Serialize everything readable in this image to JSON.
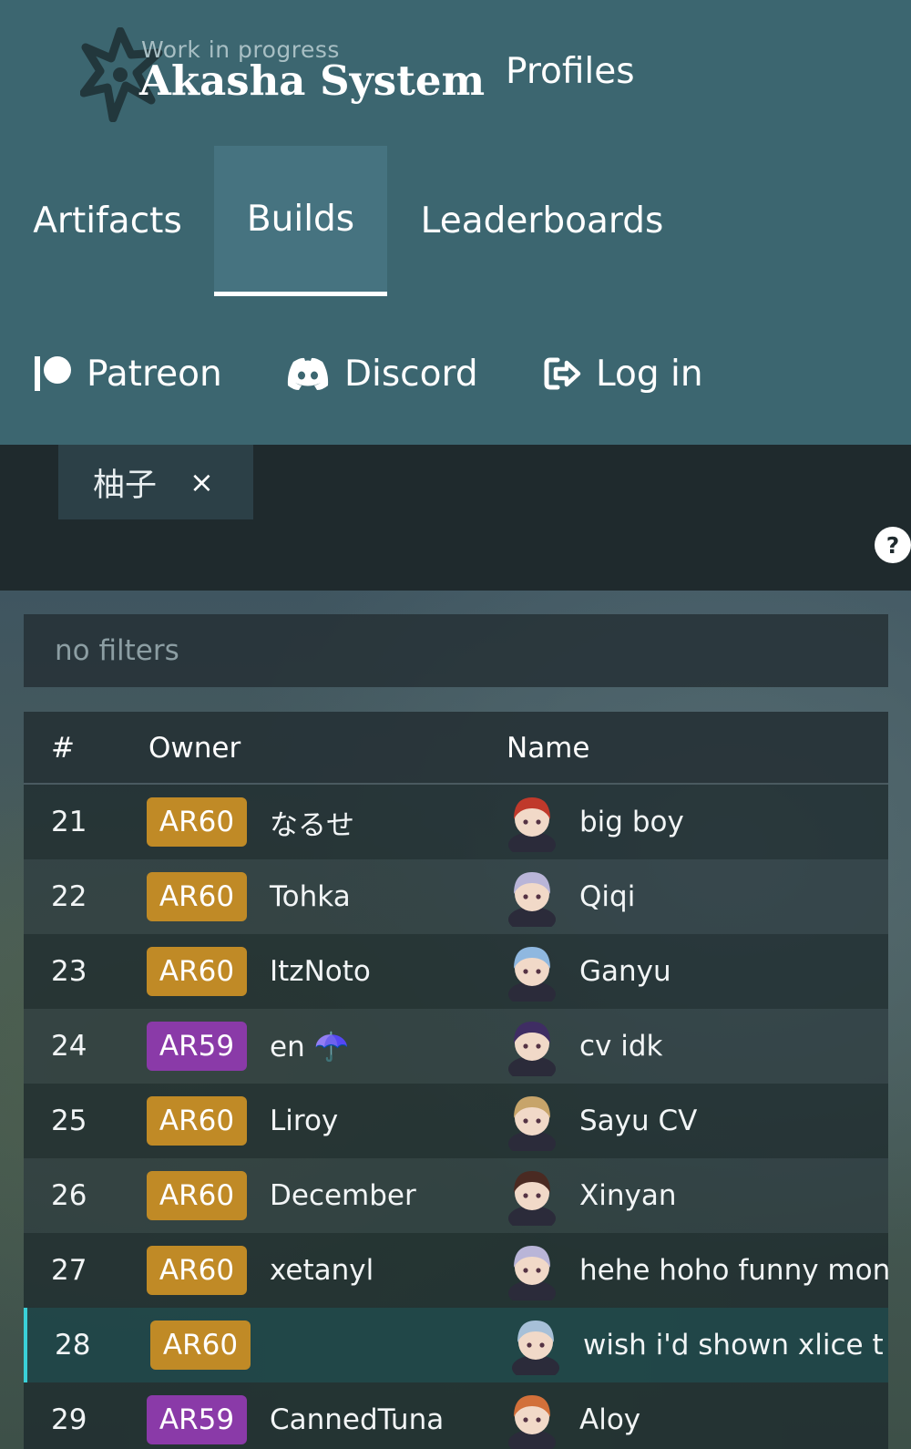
{
  "header": {
    "wip": "Work in progress",
    "title": "Akasha System",
    "profiles": "Profiles"
  },
  "tabs": [
    {
      "label": "Artifacts"
    },
    {
      "label": "Builds"
    },
    {
      "label": "Leaderboards"
    }
  ],
  "links": {
    "patreon": "Patreon",
    "discord": "Discord",
    "login": "Log in"
  },
  "filter_chip": {
    "label": "柚子",
    "close": "×"
  },
  "help": "?",
  "filters": {
    "text": "no filters"
  },
  "table": {
    "columns": {
      "rank": "#",
      "owner": "Owner",
      "name": "Name"
    },
    "rows": [
      {
        "rank": "21",
        "ar": "AR60",
        "owner": "なるせ",
        "build": "big boy",
        "avatar_color": "#c0392b",
        "badge_color": "#c08a26"
      },
      {
        "rank": "22",
        "ar": "AR60",
        "owner": "Tohka",
        "build": "Qiqi",
        "avatar_color": "#b9b5d8",
        "badge_color": "#c08a26"
      },
      {
        "rank": "23",
        "ar": "AR60",
        "owner": "ItzNoto",
        "build": "Ganyu",
        "avatar_color": "#8fb8e0",
        "badge_color": "#c08a26"
      },
      {
        "rank": "24",
        "ar": "AR59",
        "owner": "en ☂️",
        "build": "cv idk",
        "avatar_color": "#3f2d63",
        "badge_color": "#8a3aa8"
      },
      {
        "rank": "25",
        "ar": "AR60",
        "owner": "Liroy",
        "build": "Sayu CV",
        "avatar_color": "#c7a46a",
        "badge_color": "#c08a26"
      },
      {
        "rank": "26",
        "ar": "AR60",
        "owner": "December",
        "build": "Xinyan",
        "avatar_color": "#4a2a22",
        "badge_color": "#c08a26"
      },
      {
        "rank": "27",
        "ar": "AR60",
        "owner": "xetanyl",
        "build": "hehe hoho funny mon",
        "avatar_color": "#b9b5d8",
        "badge_color": "#c08a26"
      },
      {
        "rank": "28",
        "ar": "AR60",
        "owner": "",
        "build": "wish i'd shown xlice t",
        "avatar_color": "#a7c0d8",
        "badge_color": "#c08a26",
        "selected": true
      },
      {
        "rank": "29",
        "ar": "AR59",
        "owner": "CannedTuna",
        "build": "Aloy",
        "avatar_color": "#d2703a",
        "badge_color": "#8a3aa8"
      }
    ]
  }
}
